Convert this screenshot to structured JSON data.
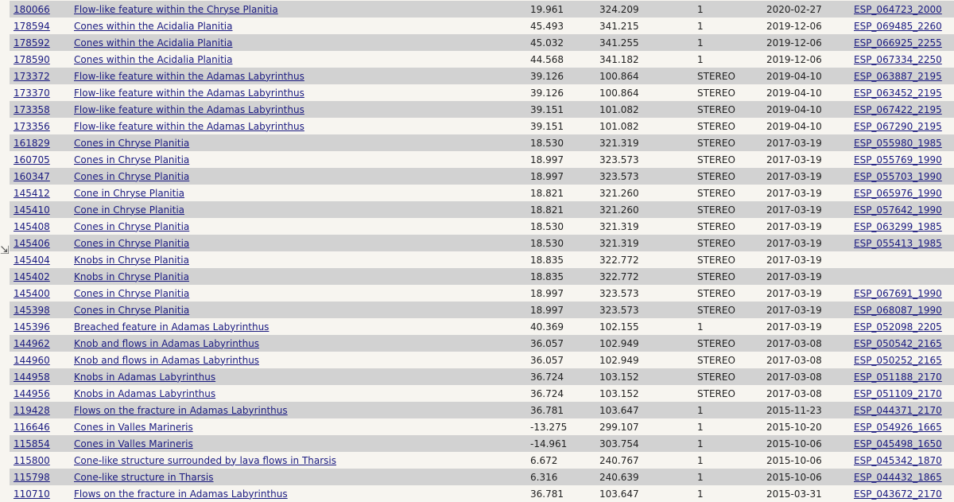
{
  "rows": [
    {
      "id": "180066",
      "title": "Flow-like feature within the Chryse Planitia",
      "lat": "19.961",
      "lon": "324.209",
      "type": "1",
      "date": "2020-02-27",
      "obs": "ESP_064723_2000"
    },
    {
      "id": "178594",
      "title": "Cones within the Acidalia Planitia",
      "lat": "45.493",
      "lon": "341.215",
      "type": "1",
      "date": "2019-12-06",
      "obs": "ESP_069485_2260"
    },
    {
      "id": "178592",
      "title": "Cones within the Acidalia Planitia",
      "lat": "45.032",
      "lon": "341.255",
      "type": "1",
      "date": "2019-12-06",
      "obs": "ESP_066925_2255"
    },
    {
      "id": "178590",
      "title": "Cones within the Acidalia Planitia",
      "lat": "44.568",
      "lon": "341.182",
      "type": "1",
      "date": "2019-12-06",
      "obs": "ESP_067334_2250"
    },
    {
      "id": "173372",
      "title": "Flow-like feature within the Adamas Labyrinthus",
      "lat": "39.126",
      "lon": "100.864",
      "type": "STEREO",
      "date": "2019-04-10",
      "obs": "ESP_063887_2195"
    },
    {
      "id": "173370",
      "title": "Flow-like feature within the Adamas Labyrinthus",
      "lat": "39.126",
      "lon": "100.864",
      "type": "STEREO",
      "date": "2019-04-10",
      "obs": "ESP_063452_2195"
    },
    {
      "id": "173358",
      "title": "Flow-like feature within the Adamas Labyrinthus",
      "lat": "39.151",
      "lon": "101.082",
      "type": "STEREO",
      "date": "2019-04-10",
      "obs": "ESP_067422_2195"
    },
    {
      "id": "173356",
      "title": "Flow-like feature within the Adamas Labyrinthus",
      "lat": "39.151",
      "lon": "101.082",
      "type": "STEREO",
      "date": "2019-04-10",
      "obs": "ESP_067290_2195"
    },
    {
      "id": "161829",
      "title": "Cones in Chryse Planitia",
      "lat": "18.530",
      "lon": "321.319",
      "type": "STEREO",
      "date": "2017-03-19",
      "obs": "ESP_055980_1985"
    },
    {
      "id": "160705",
      "title": "Cones in Chryse Planitia",
      "lat": "18.997",
      "lon": "323.573",
      "type": "STEREO",
      "date": "2017-03-19",
      "obs": "ESP_055769_1990"
    },
    {
      "id": "160347",
      "title": "Cones in Chryse Planitia",
      "lat": "18.997",
      "lon": "323.573",
      "type": "STEREO",
      "date": "2017-03-19",
      "obs": "ESP_055703_1990"
    },
    {
      "id": "145412",
      "title": "Cone in Chryse Planitia",
      "lat": "18.821",
      "lon": "321.260",
      "type": "STEREO",
      "date": "2017-03-19",
      "obs": "ESP_065976_1990"
    },
    {
      "id": "145410",
      "title": "Cone in Chryse Planitia",
      "lat": "18.821",
      "lon": "321.260",
      "type": "STEREO",
      "date": "2017-03-19",
      "obs": "ESP_057642_1990"
    },
    {
      "id": "145408",
      "title": "Cones in Chryse Planitia",
      "lat": "18.530",
      "lon": "321.319",
      "type": "STEREO",
      "date": "2017-03-19",
      "obs": "ESP_063299_1985"
    },
    {
      "id": "145406",
      "title": "Cones in Chryse Planitia",
      "lat": "18.530",
      "lon": "321.319",
      "type": "STEREO",
      "date": "2017-03-19",
      "obs": "ESP_055413_1985"
    },
    {
      "id": "145404",
      "title": "Knobs in Chryse Planitia",
      "lat": "18.835",
      "lon": "322.772",
      "type": "STEREO",
      "date": "2017-03-19",
      "obs": ""
    },
    {
      "id": "145402",
      "title": "Knobs in Chryse Planitia",
      "lat": "18.835",
      "lon": "322.772",
      "type": "STEREO",
      "date": "2017-03-19",
      "obs": ""
    },
    {
      "id": "145400",
      "title": "Cones in Chryse Planitia",
      "lat": "18.997",
      "lon": "323.573",
      "type": "STEREO",
      "date": "2017-03-19",
      "obs": "ESP_067691_1990"
    },
    {
      "id": "145398",
      "title": "Cones in Chryse Planitia",
      "lat": "18.997",
      "lon": "323.573",
      "type": "STEREO",
      "date": "2017-03-19",
      "obs": "ESP_068087_1990"
    },
    {
      "id": "145396",
      "title": "Breached feature in Adamas Labyrinthus",
      "lat": "40.369",
      "lon": "102.155",
      "type": "1",
      "date": "2017-03-19",
      "obs": "ESP_052098_2205"
    },
    {
      "id": "144962",
      "title": "Knob and flows in Adamas Labyrinthus",
      "lat": "36.057",
      "lon": "102.949",
      "type": "STEREO",
      "date": "2017-03-08",
      "obs": "ESP_050542_2165"
    },
    {
      "id": "144960",
      "title": "Knob and flows in Adamas Labyrinthus",
      "lat": "36.057",
      "lon": "102.949",
      "type": "STEREO",
      "date": "2017-03-08",
      "obs": "ESP_050252_2165"
    },
    {
      "id": "144958",
      "title": "Knobs in Adamas Labyrinthus",
      "lat": "36.724",
      "lon": "103.152",
      "type": "STEREO",
      "date": "2017-03-08",
      "obs": "ESP_051188_2170"
    },
    {
      "id": "144956",
      "title": "Knobs in Adamas Labyrinthus",
      "lat": "36.724",
      "lon": "103.152",
      "type": "STEREO",
      "date": "2017-03-08",
      "obs": "ESP_051109_2170"
    },
    {
      "id": "119428",
      "title": "Flows on the fracture in Adamas Labyrinthus",
      "lat": "36.781",
      "lon": "103.647",
      "type": "1",
      "date": "2015-11-23",
      "obs": "ESP_044371_2170"
    },
    {
      "id": "116646",
      "title": "Cones in Valles Marineris",
      "lat": "-13.275",
      "lon": "299.107",
      "type": "1",
      "date": "2015-10-20",
      "obs": "ESP_054926_1665"
    },
    {
      "id": "115854",
      "title": "Cones in Valles Marineris",
      "lat": "-14.961",
      "lon": "303.754",
      "type": "1",
      "date": "2015-10-06",
      "obs": "ESP_045498_1650"
    },
    {
      "id": "115800",
      "title": "Cone-like structure surrounded by lava flows in Tharsis",
      "lat": "6.672",
      "lon": "240.767",
      "type": "1",
      "date": "2015-10-06",
      "obs": "ESP_045342_1870"
    },
    {
      "id": "115798",
      "title": "Cone-like structure in Tharsis",
      "lat": "6.316",
      "lon": "240.639",
      "type": "1",
      "date": "2015-10-06",
      "obs": "ESP_044432_1865"
    },
    {
      "id": "110710",
      "title": "Flows on the fracture in Adamas Labyrinthus",
      "lat": "36.781",
      "lon": "103.647",
      "type": "1",
      "date": "2015-03-31",
      "obs": "ESP_043672_2170"
    }
  ],
  "cursor_glyph": "⇲"
}
